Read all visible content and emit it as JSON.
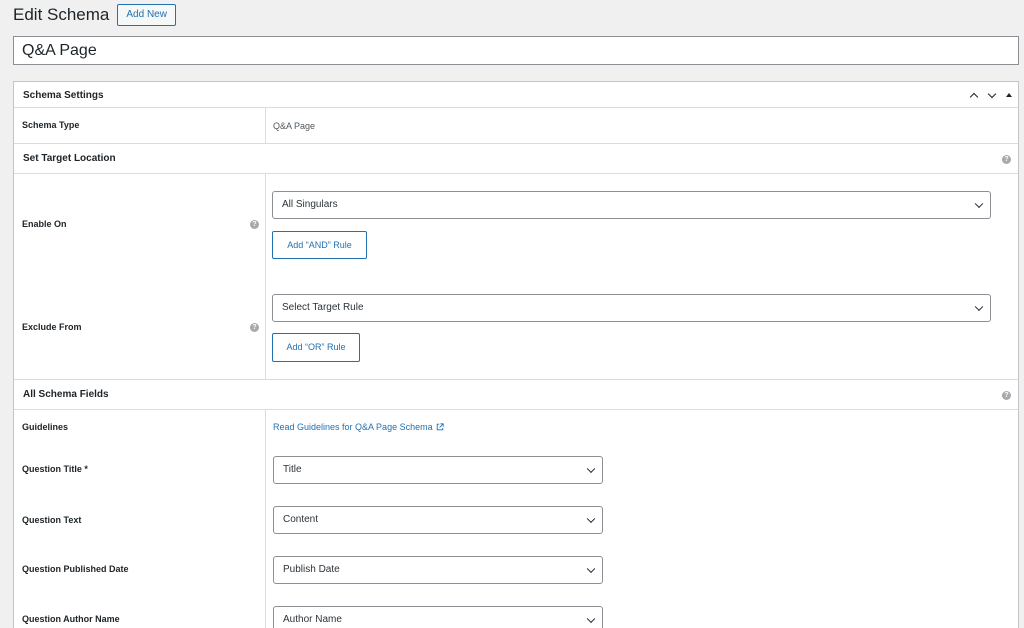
{
  "header": {
    "title": "Edit Schema",
    "add_new_label": "Add New"
  },
  "post_title": "Q&A Page",
  "settings_box": {
    "title": "Schema Settings",
    "schema_type_label": "Schema Type",
    "schema_type_value": "Q&A Page",
    "target_section_title": "Set Target Location",
    "enable_on_label": "Enable On",
    "enable_on_value": "All Singulars",
    "add_and_rule_label": "Add “AND” Rule",
    "exclude_from_label": "Exclude From",
    "exclude_from_placeholder": "Select Target Rule",
    "add_or_rule_label": "Add “OR” Rule",
    "fields_section_title": "All Schema Fields",
    "help_glyph": "?"
  },
  "fields": {
    "guidelines_label": "Guidelines",
    "guidelines_link": "Read Guidelines for Q&A Page Schema",
    "rows": [
      {
        "label": "Question Title",
        "required_mark": "*",
        "value": "Title"
      },
      {
        "label": "Question Text",
        "required_mark": "",
        "value": "Content"
      },
      {
        "label": "Question Published Date",
        "required_mark": "",
        "value": "Publish Date"
      },
      {
        "label": "Question Author Name",
        "required_mark": "",
        "value": "Author Name"
      }
    ]
  },
  "colors": {
    "accent": "#2271b1",
    "background": "#f0f0f1",
    "border": "#c3c4c7"
  },
  "icons": [
    "chevron-up-icon",
    "chevron-down-icon",
    "collapse-triangle-icon",
    "help-icon",
    "external-link-icon"
  ]
}
